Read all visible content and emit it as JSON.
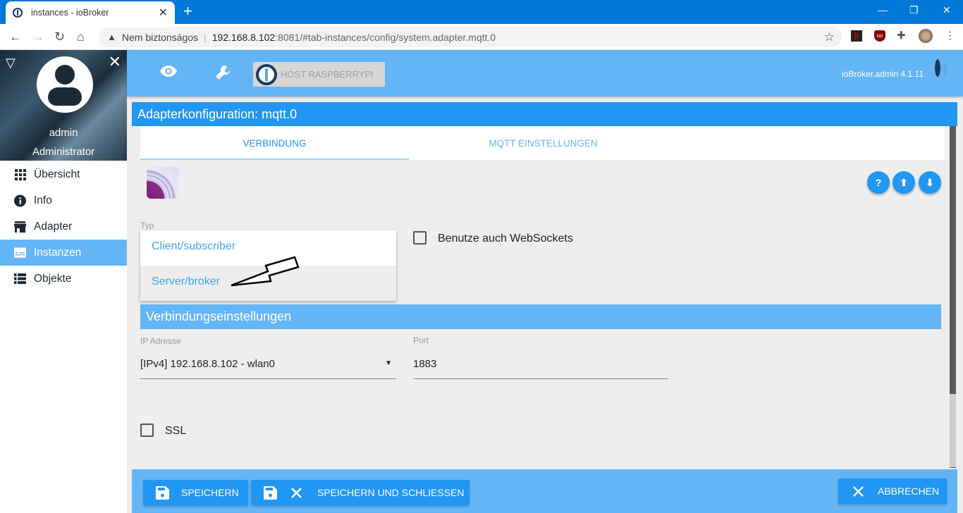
{
  "browser": {
    "tab_title": "instances - ioBroker",
    "tab_close": "✕",
    "new_tab": "+",
    "window_controls": {
      "minimize": "—",
      "restore": "❐",
      "close": "✕"
    },
    "address": {
      "security_label": "Nem biztonságos",
      "host": "192.168.8.102",
      "path": ":8081/#tab-instances/config/system.adapter.mqtt.0"
    },
    "extensions": [
      "hypothesis-icon",
      "ublock-icon",
      "extensions-puzzle-icon",
      "profile-avatar",
      "menu-kebab-icon"
    ]
  },
  "sidebar": {
    "user_name": "admin",
    "user_role": "Administrator",
    "items": [
      {
        "label": "Übersicht",
        "icon": "grid-icon",
        "active": false
      },
      {
        "label": "Info",
        "icon": "info-icon",
        "active": false
      },
      {
        "label": "Adapter",
        "icon": "store-icon",
        "active": false
      },
      {
        "label": "Instanzen",
        "icon": "instances-icon",
        "active": true
      },
      {
        "label": "Objekte",
        "icon": "list-icon",
        "active": false
      }
    ]
  },
  "appbar": {
    "host_button": "HOST RASPBERRYPI",
    "version": "ioBroker.admin 4.1.11"
  },
  "dialog": {
    "title": "Adapterkonfiguration: mqtt.0",
    "tabs": [
      {
        "label": "VERBINDUNG",
        "active": true
      },
      {
        "label": "MQTT EINSTELLUNGEN",
        "active": false
      }
    ],
    "typ": {
      "label": "Typ",
      "options": [
        "Client/subscriber",
        "Server/broker"
      ],
      "highlighted": "Server/broker"
    },
    "websockets": {
      "label": "Benutze auch WebSockets",
      "checked": false
    },
    "section_title": "Verbindungseinstellungen",
    "ip": {
      "label": "IP Adresse",
      "value": "[IPv4] 192.168.8.102 - wlan0"
    },
    "port": {
      "label": "Port",
      "value": "1883"
    },
    "ssl": {
      "label": "SSL",
      "checked": false
    },
    "buttons": {
      "save": "SPEICHERN",
      "save_close": "SPEICHERN UND SCHLIESSEN",
      "cancel": "ABBRECHEN"
    }
  },
  "colors": {
    "primary": "#2196f3",
    "light": "#64b5f6",
    "browser_frame": "#0078d7"
  }
}
